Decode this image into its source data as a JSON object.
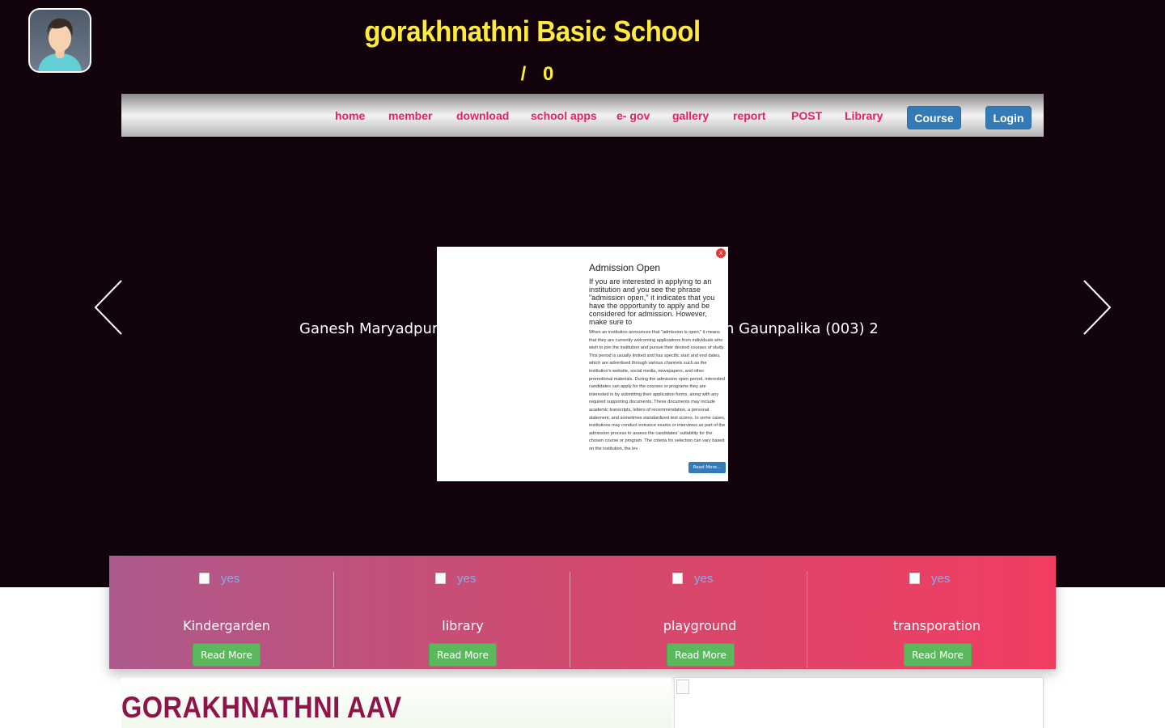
{
  "header": {
    "school_name": "gorakhnathni Basic School",
    "subline": "/ 0"
  },
  "nav": {
    "items": [
      "home",
      "member",
      "download",
      "school apps",
      "e- gov",
      "gallery",
      "report",
      "POST",
      "Library"
    ],
    "course_button": "Course",
    "login_button": "Login"
  },
  "slider": {
    "caption_left": "Ganesh Maryadpur",
    "caption_right": "n Gaunpalika (003) 2"
  },
  "popup": {
    "close_glyph": "x",
    "title": "Admission Open",
    "intro": "If you are interested in applying to an institution and you see the phrase \"admission open,\" it indicates that you have the opportunity to apply and be considered for admission. However, make sure to",
    "body": "When an institution announces that \"admission is open,\" it means that they are currently welcoming applications from individuals who wish to join the institution and pursue their desired courses of study. This period is usually limited and has specific start and end dates, which are advertised through various channels such as the institution's website, social media, newspapers, and other promotional materials. During the admission open period, interested candidates can apply for the courses or programs they are interested in by submitting their application forms, along with any required supporting documents. These documents may include academic transcripts, letters of recommendation, a personal statement, and sometimes standardized test scores. In some cases, institutions may conduct entrance exams or interviews as part of the admission process to assess the candidates' suitability for the chosen course or program. The criteria for selection can vary based on the institution, the lev",
    "read_more": "Read More..."
  },
  "features": [
    {
      "img_alt": "yes",
      "title": "Kindergarden",
      "button": "Read More"
    },
    {
      "img_alt": "yes",
      "title": "library",
      "button": "Read More"
    },
    {
      "img_alt": "yes",
      "title": "playground",
      "button": "Read More"
    },
    {
      "img_alt": "yes",
      "title": "transporation",
      "button": "Read More"
    }
  ],
  "about": {
    "title": "GORAKHNATHNI AAV"
  },
  "icons": {
    "avatar": "user-avatar-icon",
    "prev": "arrow-left-icon",
    "next": "arrow-right-icon",
    "close": "close-icon",
    "broken_image": "broken-image-icon"
  },
  "colors": {
    "hero_bg": "#13030d",
    "title": "#ffeb3b",
    "nav_text": "#e91e63",
    "nav_button": "#337ab7",
    "feature_button": "#5cb85c",
    "about_title": "#8e1449"
  }
}
